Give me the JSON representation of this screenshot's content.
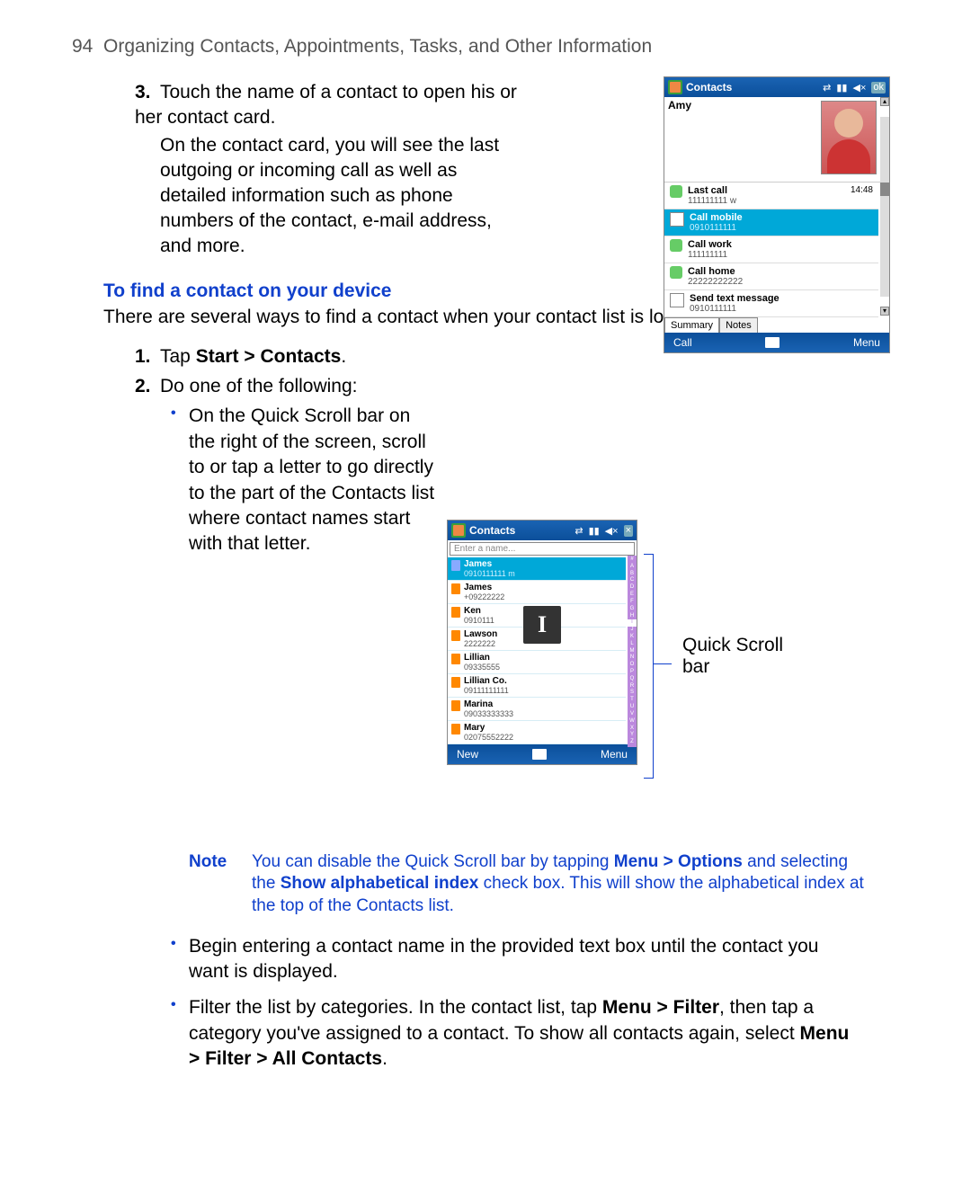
{
  "header": {
    "page_number": "94",
    "section_title": "Organizing Contacts, Appointments, Tasks, and Other Information"
  },
  "step3": {
    "num": "3.",
    "text1": "Touch the name of a contact to open his or her contact card.",
    "text2": "On the contact card, you will see the last outgoing or incoming call as well as detailed information such as phone numbers of the contact, e-mail address, and more."
  },
  "find_section": {
    "title": "To find a contact on your device",
    "intro": "There are several ways to find a contact when your contact list is long.",
    "step1": {
      "num": "1.",
      "pre": "Tap ",
      "bold": "Start > Contacts",
      "post": "."
    },
    "step2": {
      "num": "2.",
      "text": "Do one of the following:"
    },
    "bullet_quickscroll": "On the Quick Scroll bar on the right of the screen, scroll to or tap a letter to go directly to the part of the Contacts list where contact names start with that letter.",
    "quick_scroll_label": "Quick Scroll bar",
    "note": {
      "label": "Note",
      "t1": "You can disable the Quick Scroll bar by tapping ",
      "b1": "Menu > Options",
      "t2": " and selecting the ",
      "b2": "Show alphabetical index",
      "t3": " check box. This will show the alphabetical index at the top of the Contacts list."
    },
    "bullet_search": "Begin entering a contact name in the provided text box until the contact you want is displayed.",
    "bullet_filter": {
      "t1": "Filter the list by categories. In the contact list, tap ",
      "b1": "Menu > Filter",
      "t2": ", then tap a category you've assigned to a contact. To show all contacts again, select ",
      "b2": "Menu > Filter > All Contacts",
      "t3": "."
    }
  },
  "shot1": {
    "title": "Contacts",
    "ok": "ok",
    "name": "Amy",
    "rows": [
      {
        "icon": "phone",
        "label": "Last call",
        "value": "111111111 w",
        "time": "14:48",
        "sel": false
      },
      {
        "icon": "mob",
        "label": "Call mobile",
        "value": "0910111111",
        "time": "",
        "sel": true
      },
      {
        "icon": "phone",
        "label": "Call work",
        "value": "111111111",
        "time": "",
        "sel": false
      },
      {
        "icon": "phone",
        "label": "Call home",
        "value": "22222222222",
        "time": "",
        "sel": false
      },
      {
        "icon": "sms",
        "label": "Send text message",
        "value": "0910111111",
        "time": "",
        "sel": false
      }
    ],
    "tabs": [
      "Summary",
      "Notes"
    ],
    "softkeys": {
      "left": "Call",
      "right": "Menu"
    }
  },
  "shot2": {
    "title": "Contacts",
    "placeholder": "Enter a name...",
    "letter": "I",
    "rows": [
      {
        "name": "James",
        "phone": "0910111111  m",
        "sim": "card",
        "sel": true
      },
      {
        "name": "James",
        "phone": "+09222222",
        "sim": "sim",
        "sel": false
      },
      {
        "name": "Ken",
        "phone": "0910111",
        "sim": "sim",
        "sel": false
      },
      {
        "name": "Lawson",
        "phone": "2222222",
        "sim": "sim",
        "sel": false
      },
      {
        "name": "Lillian",
        "phone": "09335555",
        "sim": "sim",
        "sel": false
      },
      {
        "name": "Lillian Co.",
        "phone": "09111111111",
        "sim": "sim",
        "sel": false
      },
      {
        "name": "Marina",
        "phone": "09033333333",
        "sim": "sim",
        "sel": false
      },
      {
        "name": "Mary",
        "phone": "02075552222",
        "sim": "sim",
        "sel": false
      }
    ],
    "qsb_highlight": "I",
    "softkeys": {
      "left": "New",
      "right": "Menu"
    }
  }
}
